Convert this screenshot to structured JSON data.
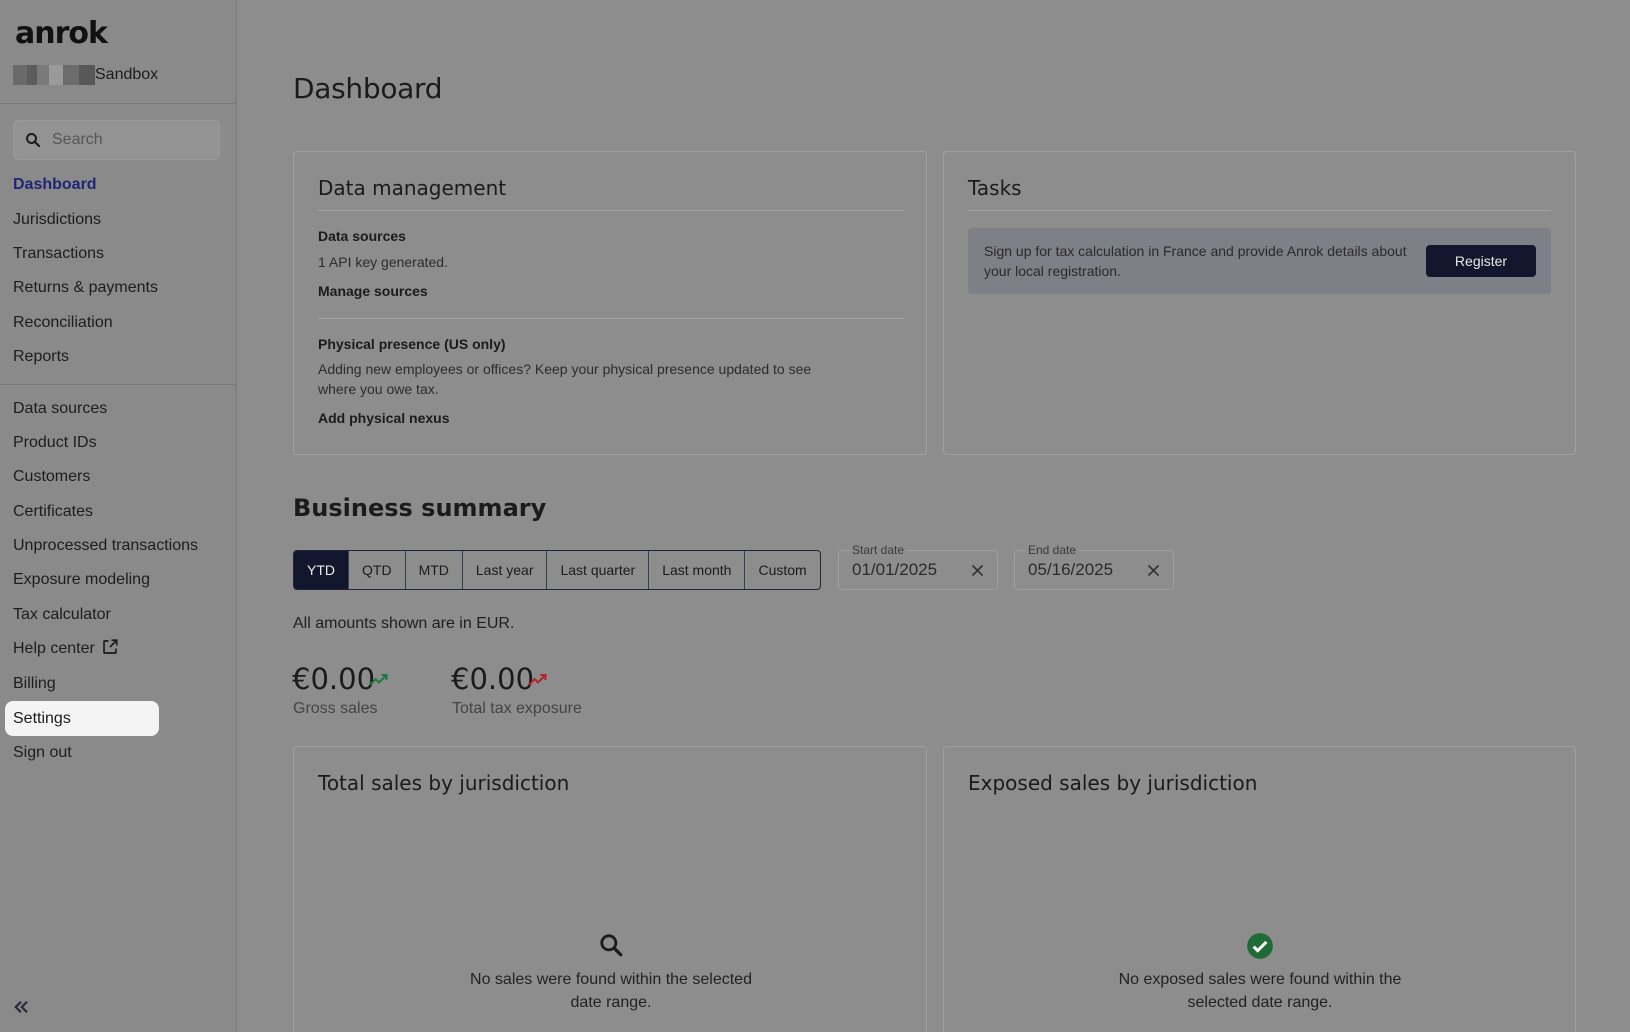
{
  "app": {
    "logo": "anrok",
    "org_name": "Sandbox"
  },
  "search": {
    "placeholder": "Search"
  },
  "nav": {
    "primary": [
      {
        "label": "Dashboard",
        "active": true
      },
      {
        "label": "Jurisdictions"
      },
      {
        "label": "Transactions"
      },
      {
        "label": "Returns & payments"
      },
      {
        "label": "Reconciliation"
      },
      {
        "label": "Reports"
      }
    ],
    "secondary": [
      {
        "label": "Data sources"
      },
      {
        "label": "Product IDs"
      },
      {
        "label": "Customers"
      },
      {
        "label": "Certificates"
      },
      {
        "label": "Unprocessed transactions"
      },
      {
        "label": "Exposure modeling"
      },
      {
        "label": "Tax calculator"
      },
      {
        "label": "Help center",
        "icon": "external-link-icon"
      },
      {
        "label": "Billing"
      },
      {
        "label": "Settings",
        "highlighted": true
      },
      {
        "label": "Sign out"
      }
    ]
  },
  "page": {
    "title": "Dashboard"
  },
  "data_management": {
    "title": "Data management",
    "sources_label": "Data sources",
    "sources_text": "1 API key generated.",
    "sources_link": "Manage sources",
    "presence_label": "Physical presence (US only)",
    "presence_text": "Adding new employees or offices? Keep your physical presence updated to see where you owe tax.",
    "presence_link": "Add physical nexus"
  },
  "tasks": {
    "title": "Tasks",
    "message": "Sign up for tax calculation in France and provide Anrok details about your local registration.",
    "button": "Register"
  },
  "business_summary": {
    "title": "Business summary",
    "periods": [
      "YTD",
      "QTD",
      "MTD",
      "Last year",
      "Last quarter",
      "Last month",
      "Custom"
    ],
    "active_period": "YTD",
    "start_date": {
      "label": "Start date",
      "value": "01/01/2025"
    },
    "end_date": {
      "label": "End date",
      "value": "05/16/2025"
    },
    "currency_note": "All amounts shown are in EUR.",
    "gross_sales": {
      "value": "€0.00",
      "label": "Gross sales",
      "trend": "up",
      "color": "#1f7a3a"
    },
    "tax_exposure": {
      "value": "€0.00",
      "label": "Total tax exposure",
      "trend": "up",
      "color": "#b0242b"
    }
  },
  "total_sales": {
    "title": "Total sales by jurisdiction",
    "empty": "No sales were found within the selected date range.",
    "icon": "search-icon"
  },
  "exposed_sales": {
    "title": "Exposed sales by jurisdiction",
    "empty": "No exposed sales were found within the selected date range.",
    "icon": "check-circle-icon",
    "icon_color": "#1e6b35"
  }
}
